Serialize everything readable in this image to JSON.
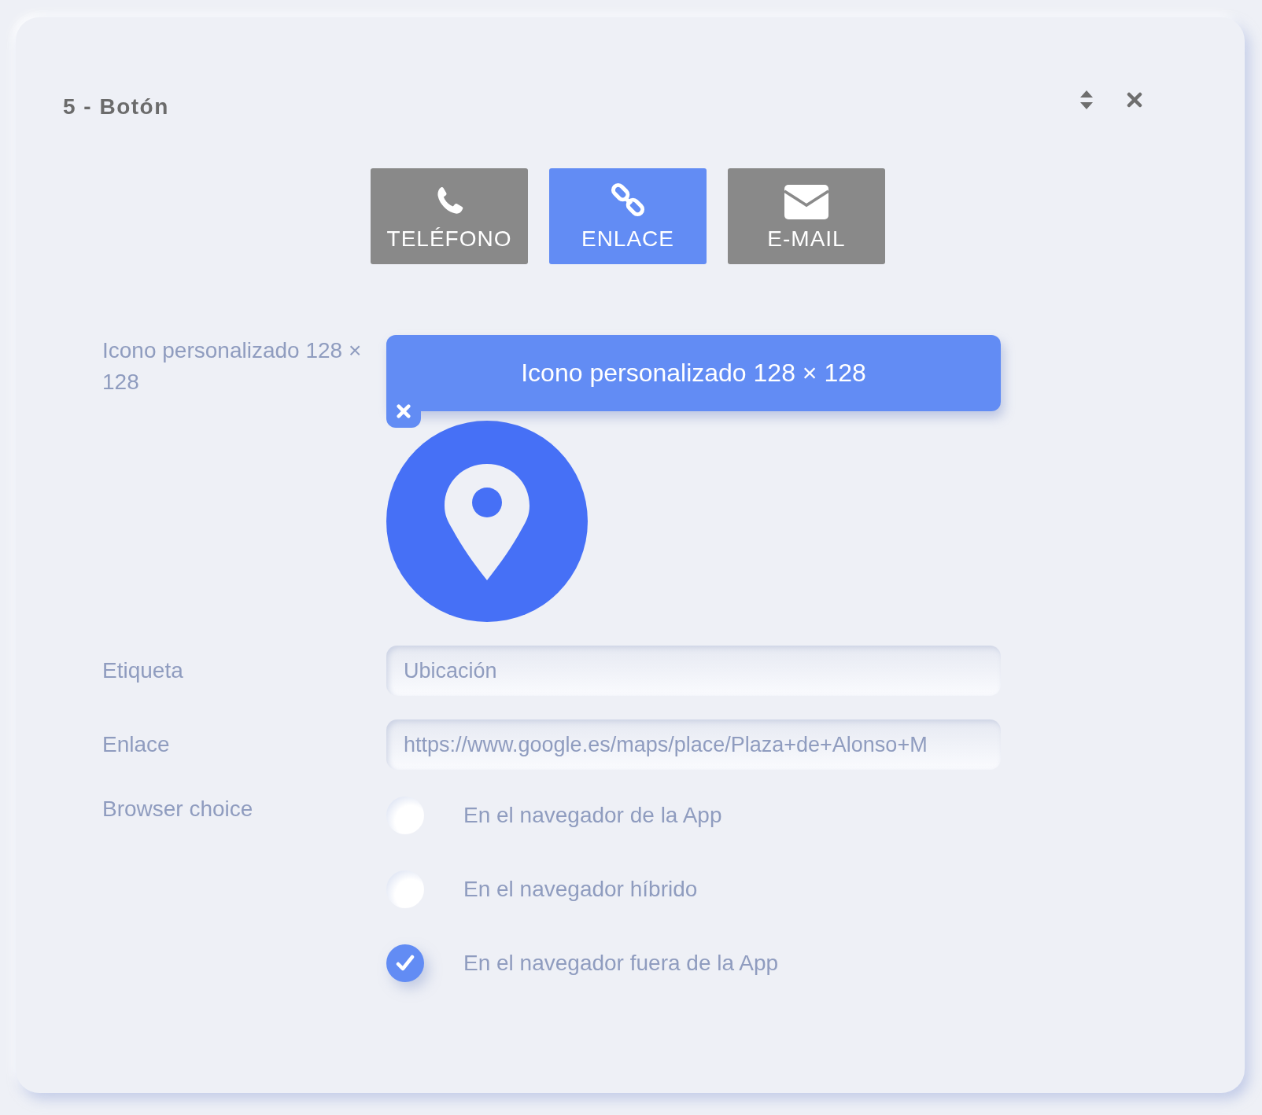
{
  "panel": {
    "title": "5 - Botón"
  },
  "types": [
    {
      "kind": "phone",
      "label": "TELÉFONO",
      "selected": false
    },
    {
      "kind": "link",
      "label": "ENLACE",
      "selected": true
    },
    {
      "kind": "mail",
      "label": "E-MAIL",
      "selected": false
    }
  ],
  "icon_field": {
    "label": "Icono personalizado 128 × 128",
    "upload_button": "Icono personalizado 128 × 128"
  },
  "label_field": {
    "label": "Etiqueta",
    "value": "Ubicación"
  },
  "link_field": {
    "label": "Enlace",
    "value": "https://www.google.es/maps/place/Plaza+de+Alonso+M"
  },
  "browser_choice": {
    "label": "Browser choice",
    "options": [
      {
        "label": "En el navegador de la App",
        "selected": false
      },
      {
        "label": "En el navegador híbrido",
        "selected": false
      },
      {
        "label": "En el navegador fuera de la App",
        "selected": true
      }
    ]
  }
}
